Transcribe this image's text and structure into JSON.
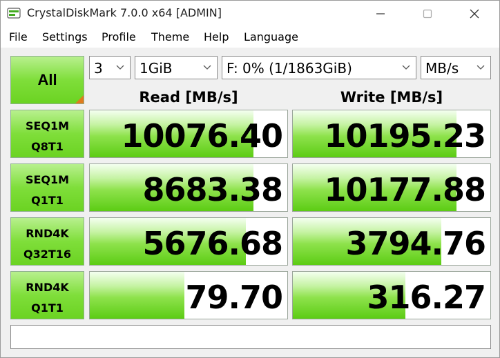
{
  "window": {
    "title": "CrystalDiskMark 7.0.0 x64 [ADMIN]"
  },
  "menu": [
    "File",
    "Settings",
    "Profile",
    "Theme",
    "Help",
    "Language"
  ],
  "controls": {
    "all_label": "All",
    "count": "3",
    "size": "1GiB",
    "drive": "F: 0% (1/1863GiB)",
    "unit": "MB/s"
  },
  "headers": {
    "read": "Read [MB/s]",
    "write": "Write [MB/s]"
  },
  "tests": [
    {
      "line1": "SEQ1M",
      "line2": "Q8T1",
      "read": "10076.40",
      "write": "10195.23",
      "read_fill": 0.83,
      "write_fill": 0.83
    },
    {
      "line1": "SEQ1M",
      "line2": "Q1T1",
      "read": "8683.38",
      "write": "10177.88",
      "read_fill": 0.83,
      "write_fill": 0.83
    },
    {
      "line1": "RND4K",
      "line2": "Q32T16",
      "read": "5676.68",
      "write": "3794.76",
      "read_fill": 0.79,
      "write_fill": 0.75
    },
    {
      "line1": "RND4K",
      "line2": "Q1T1",
      "read": "79.70",
      "write": "316.27",
      "read_fill": 0.48,
      "write_fill": 0.57
    }
  ],
  "comment": "",
  "colors": {
    "accent_green": "#6bd322",
    "corner_orange": "#e07b1d"
  },
  "icons": {
    "app": "crystaldiskmark-app-icon",
    "minimize": "minimize-icon",
    "maximize": "maximize-icon",
    "close": "close-icon"
  }
}
